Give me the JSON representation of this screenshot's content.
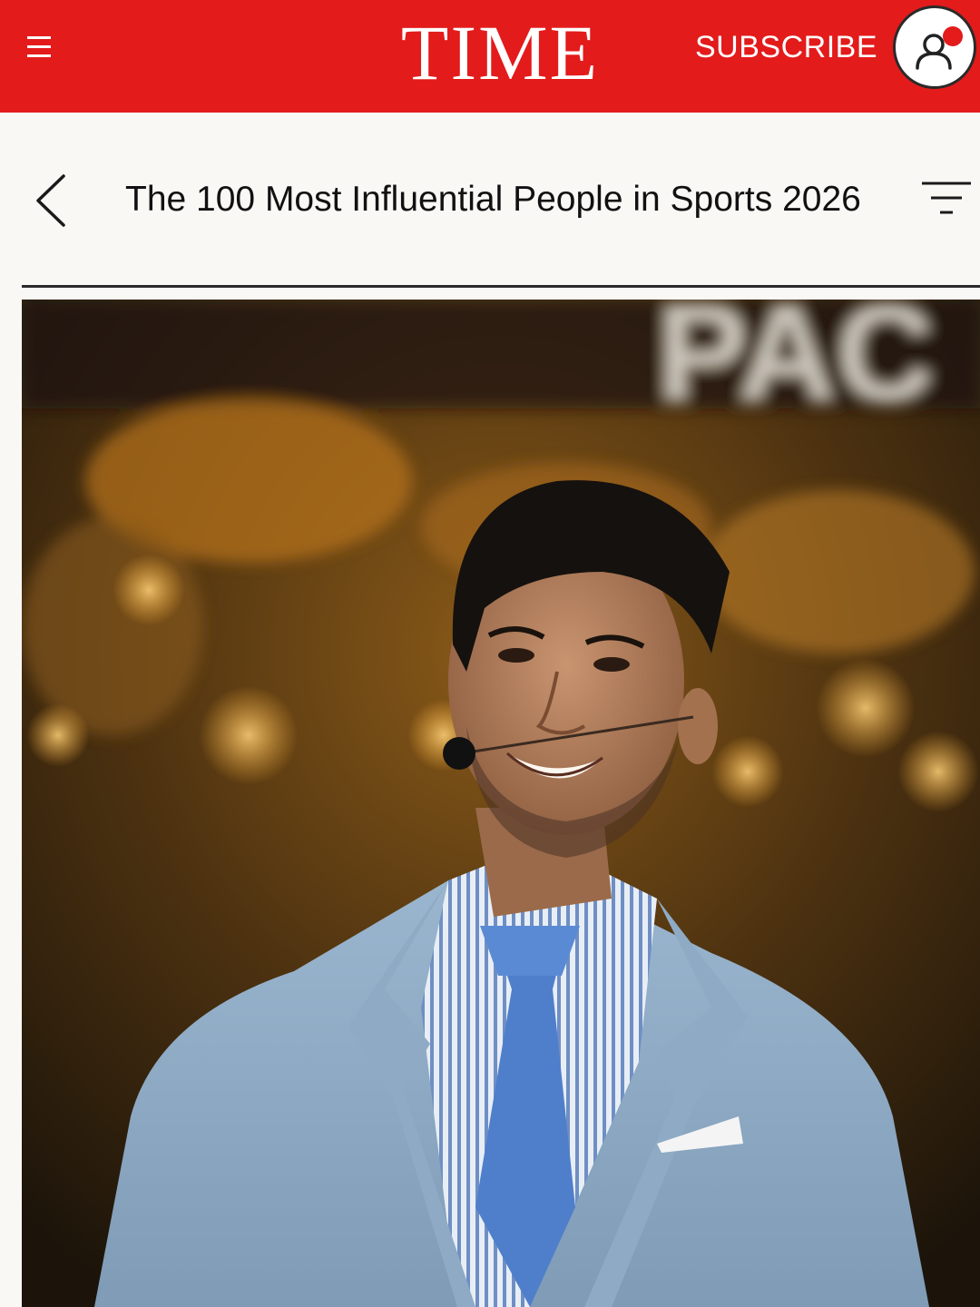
{
  "header": {
    "logo_text": "TIME",
    "subscribe_label": "SUBSCRIBE",
    "background_color": "#e31b1b"
  },
  "icons": {
    "menu": "menu-icon",
    "account": "account-icon",
    "back": "back-arrow-icon",
    "filter": "filter-icon"
  },
  "page": {
    "title": "The 100 Most Influential People in Sports 2026"
  }
}
